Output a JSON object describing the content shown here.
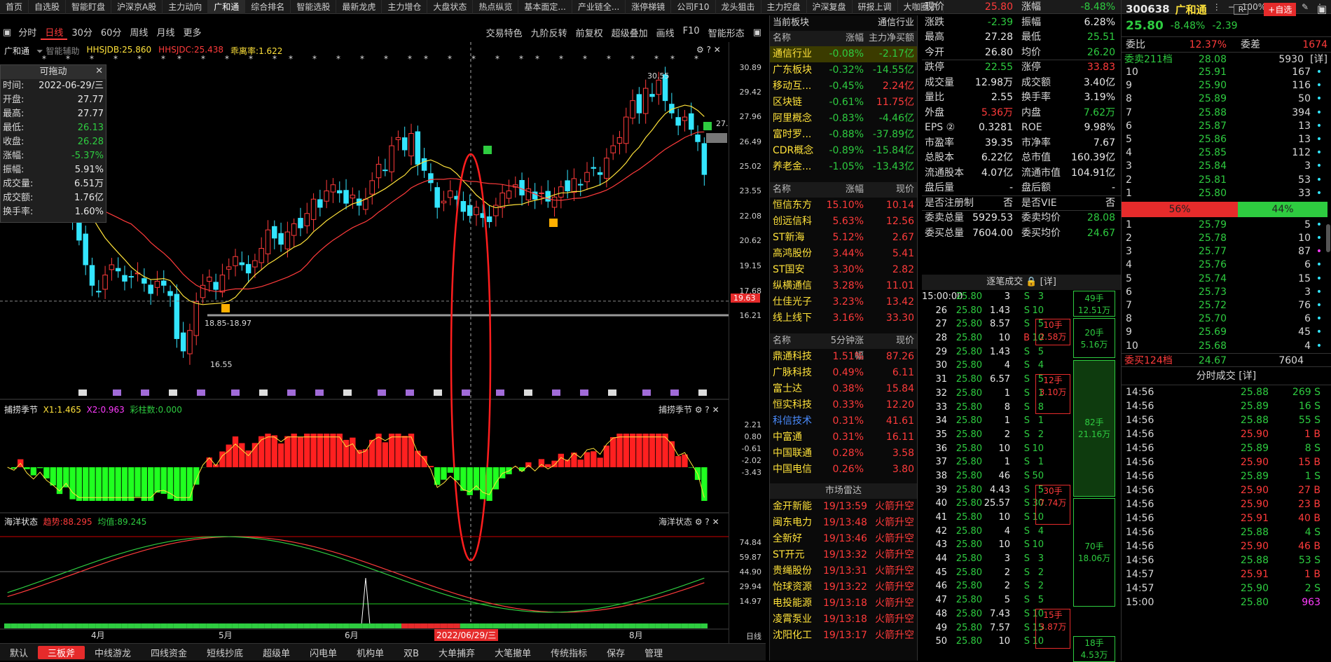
{
  "topbar": {
    "tabs": [
      "首页",
      "自选股",
      "智能盯盘",
      "沪深京A股",
      "主力动向",
      "广和通",
      "综合排名",
      "智能选股",
      "最新龙虎",
      "主力增仓",
      "大盘状态",
      "热点纵览",
      "基本面定...",
      "产业链全...",
      "涨停梯镜",
      "公司F10",
      "龙头狙击",
      "主力控盘",
      "沪深复盘",
      "研报上调",
      "大咖圈子"
    ],
    "active": 5,
    "zoom": "100%"
  },
  "toolbar": {
    "periods": [
      "分时",
      "日线",
      "30分",
      "60分",
      "周线",
      "月线",
      "更多"
    ],
    "active": 1,
    "right": [
      "交易特色",
      "九阶反转",
      "前复权",
      "超级叠加",
      "画线",
      "F10",
      "智能形态"
    ]
  },
  "chart_head": {
    "name": "广和通",
    "assist": "智能辅助",
    "hhsjdb": "HHSJDB:25.860",
    "hhsjdc": "HHSJDC:25.438",
    "deviation": "乖离率:1.622"
  },
  "infobox": {
    "title": "可拖动",
    "rows": [
      [
        "时间:",
        "2022-06-29/三",
        "white"
      ],
      [
        "开盘:",
        "27.77",
        "white"
      ],
      [
        "最高:",
        "27.77",
        "white"
      ],
      [
        "最低:",
        "26.13",
        "green"
      ],
      [
        "收盘:",
        "26.28",
        "green"
      ],
      [
        "涨幅:",
        "-5.37%",
        "green"
      ],
      [
        "振幅:",
        "5.91%",
        "white"
      ],
      [
        "成交量:",
        "6.51万",
        "white"
      ],
      [
        "成交额:",
        "1.76亿",
        "white"
      ],
      [
        "换手率:",
        "1.60%",
        "white"
      ]
    ]
  },
  "price_axis": [
    "30.89",
    "29.42",
    "27.96",
    "26.49",
    "25.02",
    "23.55",
    "22.08",
    "20.62",
    "19.15",
    "17.68",
    "16.21"
  ],
  "price_tag": "19.63",
  "annotations": {
    "low": "16.55",
    "high": "30.55",
    "range": "18.85-18.97",
    "last": "27.81-27.2"
  },
  "sub1": {
    "name": "捕捞季节",
    "x1": "X1:1.465",
    "x2": "X2:0.963",
    "bars": "彩柱数:0.000",
    "axis": [
      "2.21",
      "0.80",
      "-0.61",
      "-2.02",
      "-3.43"
    ]
  },
  "sub2": {
    "name": "海洋状态",
    "trend": "趋势:88.295",
    "avg": "均值:89.245",
    "axis": [
      "74.84",
      "59.87",
      "44.90",
      "29.94",
      "14.97"
    ]
  },
  "xaxis": {
    "labels": [
      "4月",
      "5月",
      "6月",
      "2022/06/29/三",
      "8月"
    ],
    "period": "日线"
  },
  "bottombar": [
    "默认",
    "三板斧",
    "中线游龙",
    "四线资金",
    "短线抄底",
    "超级单",
    "闪电单",
    "机构单",
    "双B",
    "大单捕弃",
    "大笔撤单",
    "传统指标",
    "保存",
    "管理"
  ],
  "sector": {
    "title": "当前板块",
    "industry": "通信行业",
    "cols": [
      "名称",
      "涨幅",
      "主力净买额"
    ],
    "rows": [
      [
        "通信行业",
        "-0.08%",
        "-2.17亿"
      ],
      [
        "广东板块",
        "-0.32%",
        "-14.55亿"
      ],
      [
        "移动互...",
        "-0.45%",
        "2.24亿"
      ],
      [
        "区块链",
        "-0.61%",
        "11.75亿"
      ],
      [
        "阿里概念",
        "-0.83%",
        "-4.46亿"
      ],
      [
        "富时罗...",
        "-0.88%",
        "-37.89亿"
      ],
      [
        "CDR概念",
        "-0.89%",
        "-15.84亿"
      ],
      [
        "养老金...",
        "-1.05%",
        "-13.43亿"
      ]
    ]
  },
  "stocks": {
    "cols": [
      "名称",
      "涨幅",
      "现价"
    ],
    "rows": [
      [
        "恒信东方",
        "15.10%",
        "10.14"
      ],
      [
        "创远信科",
        "5.63%",
        "12.56"
      ],
      [
        "ST新海",
        "5.12%",
        "2.67"
      ],
      [
        "高鸿股份",
        "3.44%",
        "5.41"
      ],
      [
        "ST国安",
        "3.30%",
        "2.82"
      ],
      [
        "纵横通信",
        "3.28%",
        "11.01"
      ],
      [
        "仕佳光子",
        "3.23%",
        "13.42"
      ],
      [
        "线上线下",
        "3.16%",
        "33.30"
      ]
    ]
  },
  "fast": {
    "cols": [
      "名称",
      "5分钟涨幅",
      "现价"
    ],
    "rows": [
      [
        "鼎通科技",
        "1.51%",
        "87.26"
      ],
      [
        "广脉科技",
        "0.49%",
        "6.11"
      ],
      [
        "富士达",
        "0.38%",
        "15.84"
      ],
      [
        "恒实科技",
        "0.33%",
        "12.20"
      ],
      [
        "科信技术",
        "0.31%",
        "41.61"
      ],
      [
        "中富通",
        "0.31%",
        "16.11"
      ],
      [
        "中国联通",
        "0.28%",
        "3.58"
      ],
      [
        "中国电信",
        "0.26%",
        "3.80"
      ]
    ]
  },
  "radar": {
    "title": "市场雷达",
    "rows": [
      [
        "金开新能",
        "19/13:59",
        "火箭升空"
      ],
      [
        "闽东电力",
        "19/13:48",
        "火箭升空"
      ],
      [
        "全新好",
        "19/13:46",
        "火箭升空"
      ],
      [
        "ST开元",
        "19/13:32",
        "火箭升空"
      ],
      [
        "贵绳股份",
        "19/13:31",
        "火箭升空"
      ],
      [
        "怡球资源",
        "19/13:22",
        "火箭升空"
      ],
      [
        "电投能源",
        "19/13:18",
        "火箭升空"
      ],
      [
        "凌霄泵业",
        "19/13:18",
        "火箭升空"
      ],
      [
        "沈阳化工",
        "19/13:17",
        "火箭升空"
      ]
    ]
  },
  "quote": [
    [
      "现价",
      "25.80",
      "red",
      "涨幅",
      "-8.48%",
      "green"
    ],
    [
      "涨跌",
      "-2.39",
      "green",
      "振幅",
      "6.28%",
      "white"
    ],
    [
      "最高",
      "27.28",
      "white",
      "最低",
      "25.51",
      "green"
    ],
    [
      "今开",
      "26.80",
      "white",
      "均价",
      "26.20",
      "green"
    ],
    [
      "跌停",
      "22.55",
      "green",
      "涨停",
      "33.83",
      "red"
    ],
    [
      "成交量",
      "12.98万",
      "white",
      "成交额",
      "3.40亿",
      "white"
    ],
    [
      "量比",
      "2.55",
      "white",
      "换手率",
      "3.19%",
      "white"
    ],
    [
      "外盘",
      "5.36万",
      "red",
      "内盘",
      "7.62万",
      "green"
    ],
    [
      "EPS ②",
      "0.3281",
      "white",
      "ROE",
      "9.98%",
      "white"
    ],
    [
      "市盈率",
      "39.35",
      "white",
      "市净率",
      "7.67",
      "white"
    ],
    [
      "总股本",
      "6.22亿",
      "white",
      "总市值",
      "160.39亿",
      "white"
    ],
    [
      "流通股本",
      "4.07亿",
      "white",
      "流通市值",
      "104.91亿",
      "white"
    ],
    [
      "盘后量",
      "-",
      "white",
      "盘后额",
      "-",
      "white"
    ],
    [
      "是否注册制",
      "否",
      "white",
      "是否VIE",
      "否",
      "white"
    ],
    [
      "委卖总量",
      "5929.53",
      "white",
      "委卖均价",
      "28.08",
      "green"
    ],
    [
      "委买总量",
      "7604.00",
      "white",
      "委买均价",
      "24.67",
      "green"
    ]
  ],
  "ticks": {
    "title": "逐笔成交",
    "detail": "[详]",
    "rows": [
      [
        "15:00:00",
        "25.80",
        "3",
        "S",
        "3"
      ],
      [
        "26",
        "25.80",
        "1.43",
        "S",
        "10"
      ],
      [
        "27",
        "25.80",
        "8.57",
        "S",
        "5"
      ],
      [
        "28",
        "25.80",
        "10",
        "B",
        "10"
      ],
      [
        "29",
        "25.80",
        "1.43",
        "S",
        "5"
      ],
      [
        "30",
        "25.80",
        "4",
        "S",
        "4"
      ],
      [
        "31",
        "25.80",
        "6.57",
        "S",
        "5"
      ],
      [
        "32",
        "25.80",
        "1",
        "S",
        "1"
      ],
      [
        "33",
        "25.80",
        "8",
        "S",
        "8"
      ],
      [
        "34",
        "25.80",
        "1",
        "S",
        "1"
      ],
      [
        "35",
        "25.80",
        "2",
        "S",
        "2"
      ],
      [
        "36",
        "25.80",
        "10",
        "S",
        "10"
      ],
      [
        "37",
        "25.80",
        "1",
        "S",
        "1"
      ],
      [
        "38",
        "25.80",
        "46",
        "S",
        "50"
      ],
      [
        "39",
        "25.80",
        "4.43",
        "S",
        "5"
      ],
      [
        "40",
        "25.80",
        "25.57",
        "S",
        "30"
      ],
      [
        "41",
        "25.80",
        "10",
        "S",
        "10"
      ],
      [
        "42",
        "25.80",
        "4",
        "S",
        "4"
      ],
      [
        "43",
        "25.80",
        "10",
        "S",
        "10"
      ],
      [
        "44",
        "25.80",
        "3",
        "S",
        "3"
      ],
      [
        "45",
        "25.80",
        "2",
        "S",
        "2"
      ],
      [
        "46",
        "25.80",
        "2",
        "S",
        "2"
      ],
      [
        "47",
        "25.80",
        "5",
        "S",
        "5"
      ],
      [
        "48",
        "25.80",
        "7.43",
        "S",
        "10"
      ],
      [
        "49",
        "25.80",
        "7.57",
        "S",
        "15"
      ],
      [
        "50",
        "25.80",
        "10",
        "S",
        "10"
      ]
    ],
    "boxes": [
      [
        "10手",
        "2.58万",
        2,
        3
      ],
      [
        "12手",
        "3.10万",
        6,
        8
      ],
      [
        "30手",
        "7.74万",
        14,
        16
      ],
      [
        "15手",
        "3.87万",
        23,
        25
      ]
    ],
    "bigboxes": [
      [
        "49手",
        "12.51万",
        0,
        1
      ],
      [
        "20手",
        "5.16万",
        2,
        4
      ],
      [
        "4",
        "",
        5,
        5
      ],
      [
        "82手",
        "21.16万",
        5,
        14
      ],
      [
        "70手",
        "18.06万",
        15,
        22
      ],
      [
        "18手",
        "4.53万",
        25,
        26
      ]
    ]
  },
  "stock": {
    "code": "300638",
    "name": "广和通",
    "tag": "R",
    "add": "+自选",
    "price": "25.80",
    "pct": "-8.48%",
    "chg": "-2.39"
  },
  "ratio": {
    "wb_label": "委比",
    "wb": "12.37%",
    "wc_label": "委差",
    "wc": "1674",
    "sell_label": "委卖211档",
    "sell_avg": "28.08",
    "sell_total": "5930",
    "buy_label": "委买124档",
    "buy_avg": "24.67",
    "buy_total": "7604",
    "detail": "[详]",
    "bar_left": "56%",
    "bar_right": "44%"
  },
  "asks": [
    [
      "10",
      "25.91",
      "167",
      "c"
    ],
    [
      "9",
      "25.90",
      "116",
      "c"
    ],
    [
      "8",
      "25.89",
      "50",
      "c"
    ],
    [
      "7",
      "25.88",
      "394",
      "c"
    ],
    [
      "6",
      "25.87",
      "13",
      "c"
    ],
    [
      "5",
      "25.86",
      "13",
      "c"
    ],
    [
      "4",
      "25.85",
      "112",
      "c"
    ],
    [
      "3",
      "25.84",
      "3",
      "c"
    ],
    [
      "2",
      "25.81",
      "53",
      "c"
    ],
    [
      "1",
      "25.80",
      "33",
      "c"
    ]
  ],
  "bids": [
    [
      "1",
      "25.79",
      "5",
      "c"
    ],
    [
      "2",
      "25.78",
      "10",
      "c"
    ],
    [
      "3",
      "25.77",
      "87",
      "p"
    ],
    [
      "4",
      "25.76",
      "6",
      "c"
    ],
    [
      "5",
      "25.74",
      "15",
      "c"
    ],
    [
      "6",
      "25.73",
      "3",
      "c"
    ],
    [
      "7",
      "25.72",
      "76",
      "c"
    ],
    [
      "8",
      "25.70",
      "6",
      "c"
    ],
    [
      "9",
      "25.69",
      "45",
      "c"
    ],
    [
      "10",
      "25.68",
      "4",
      "c"
    ]
  ],
  "fenshi": {
    "title": "分时成交",
    "detail": "[详]",
    "rows": [
      [
        "14:56",
        "25.88",
        "269",
        "S",
        "green"
      ],
      [
        "14:56",
        "25.89",
        "16",
        "S",
        "green"
      ],
      [
        "14:56",
        "25.88",
        "55",
        "S",
        "green"
      ],
      [
        "14:56",
        "25.90",
        "1",
        "B",
        "red"
      ],
      [
        "14:56",
        "25.89",
        "8",
        "S",
        "green"
      ],
      [
        "14:56",
        "25.90",
        "15",
        "B",
        "red"
      ],
      [
        "14:56",
        "25.89",
        "1",
        "S",
        "green"
      ],
      [
        "14:56",
        "25.90",
        "27",
        "B",
        "red"
      ],
      [
        "14:56",
        "25.90",
        "23",
        "B",
        "red"
      ],
      [
        "14:56",
        "25.91",
        "40",
        "B",
        "red"
      ],
      [
        "14:56",
        "25.88",
        "4",
        "S",
        "green"
      ],
      [
        "14:56",
        "25.90",
        "46",
        "B",
        "red"
      ],
      [
        "14:56",
        "25.88",
        "53",
        "S",
        "green"
      ],
      [
        "14:57",
        "25.91",
        "1",
        "B",
        "red"
      ],
      [
        "14:57",
        "25.90",
        "2",
        "S",
        "green"
      ],
      [
        "15:00",
        "25.80",
        "963",
        "",
        ""
      ]
    ]
  },
  "colors": {
    "up": "#ff3b3b",
    "down": "#33e5ff",
    "ma1": "#ffe23a",
    "ma2": "#ff3b3b",
    "highlight": "#e62b2b"
  },
  "chart_data": {
    "type": "candlestick",
    "values_note": "daily OHLC approximated",
    "series_count": 1
  }
}
